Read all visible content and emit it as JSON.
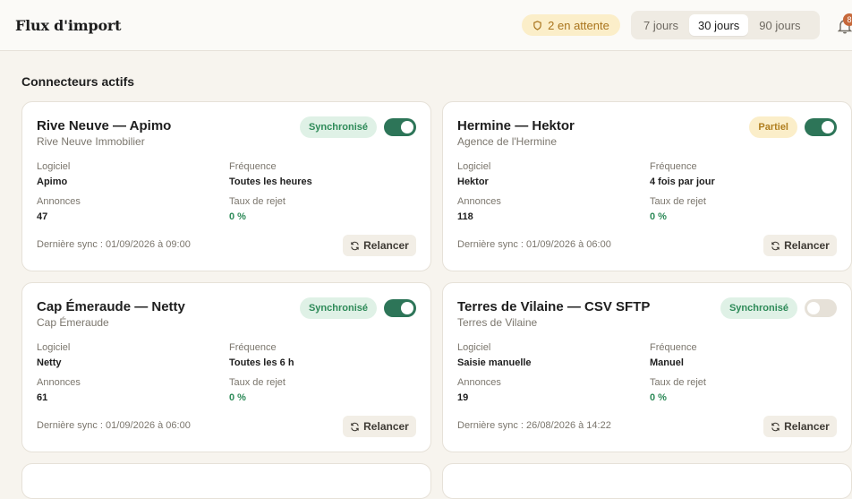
{
  "header": {
    "title": "Flux d'import",
    "pending_label": "2 en attente",
    "periods": [
      "7 jours",
      "30 jours",
      "90 jours"
    ],
    "active_period": "30 jours",
    "notifications_count": "8"
  },
  "section_title": "Connecteurs actifs",
  "labels": {
    "software": "Logiciel",
    "frequency": "Fréquence",
    "listings": "Annonces",
    "reject_rate": "Taux de rejet",
    "relaunch": "Relancer"
  },
  "colors": {
    "accent": "#2d7558",
    "ok": "#2d8a58",
    "partial": "#b07e1f",
    "badge": "#c6683a"
  },
  "connectors": [
    {
      "title": "Rive Neuve — Apimo",
      "agency": "Rive Neuve Immobilier",
      "status": "Synchronisé",
      "status_kind": "ok",
      "enabled": true,
      "software": "Apimo",
      "frequency": "Toutes les heures",
      "listings": "47",
      "reject_rate": "0 %",
      "last_sync": "Dernière sync : 01/09/2026 à 09:00"
    },
    {
      "title": "Hermine — Hektor",
      "agency": "Agence de l'Hermine",
      "status": "Partiel",
      "status_kind": "partial",
      "enabled": true,
      "software": "Hektor",
      "frequency": "4 fois par jour",
      "listings": "118",
      "reject_rate": "0 %",
      "last_sync": "Dernière sync : 01/09/2026 à 06:00"
    },
    {
      "title": "Cap Émeraude — Netty",
      "agency": "Cap Émeraude",
      "status": "Synchronisé",
      "status_kind": "ok",
      "enabled": true,
      "software": "Netty",
      "frequency": "Toutes les 6 h",
      "listings": "61",
      "reject_rate": "0 %",
      "last_sync": "Dernière sync : 01/09/2026 à 06:00"
    },
    {
      "title": "Terres de Vilaine — CSV SFTP",
      "agency": "Terres de Vilaine",
      "status": "Synchronisé",
      "status_kind": "ok",
      "enabled": false,
      "software": "Saisie manuelle",
      "frequency": "Manuel",
      "listings": "19",
      "reject_rate": "0 %",
      "last_sync": "Dernière sync : 26/08/2026 à 14:22"
    }
  ]
}
